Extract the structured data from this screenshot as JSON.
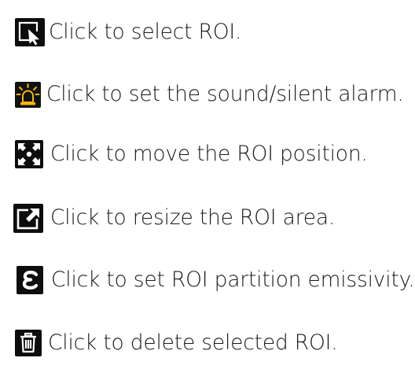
{
  "legend": {
    "items": [
      {
        "icon": "cursor-select-icon",
        "label": "Click to select ROI."
      },
      {
        "icon": "alarm-light-icon",
        "label": "Click to set the sound/silent alarm."
      },
      {
        "icon": "move-arrows-icon",
        "label": "Click to move the ROI position."
      },
      {
        "icon": "resize-icon",
        "label": "Click to resize the ROI area."
      },
      {
        "icon": "emissivity-epsilon-icon",
        "label": "Click to set ROI partition emissivity."
      },
      {
        "icon": "trash-icon",
        "label": "Click to delete selected ROI."
      }
    ]
  },
  "colors": {
    "icon_background": "#0d0d0d",
    "icon_foreground": "#ffffff",
    "alarm_accent": "#f2b705",
    "text": "#1a1a1a"
  }
}
